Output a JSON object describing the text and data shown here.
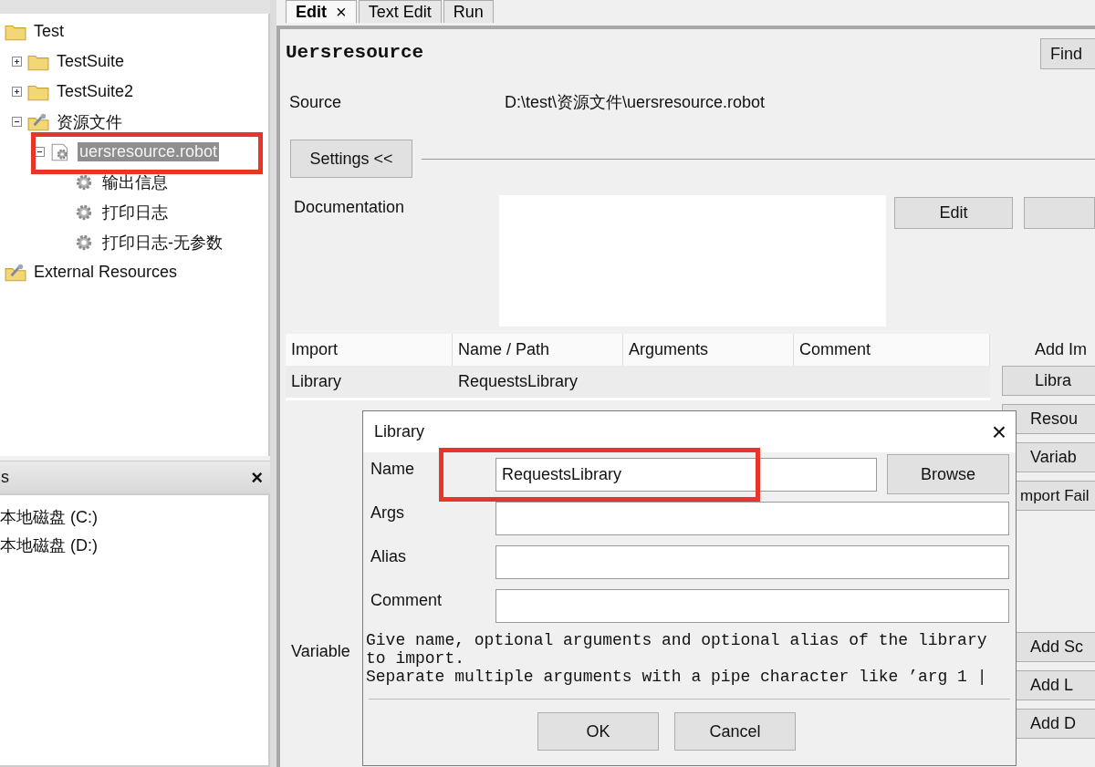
{
  "tree": [
    {
      "label": "Test",
      "kind": "folder",
      "children": [
        {
          "label": "TestSuite",
          "kind": "folder",
          "expanded": false
        },
        {
          "label": "TestSuite2",
          "kind": "folder",
          "expanded": false
        },
        {
          "label": "资源文件",
          "kind": "resource-folder",
          "expanded": true,
          "children": [
            {
              "label": "uersresource.robot",
              "kind": "resource-file",
              "expanded": true,
              "selected": true,
              "children": [
                {
                  "label": "输出信息",
                  "kind": "keyword"
                },
                {
                  "label": "打印日志",
                  "kind": "keyword"
                },
                {
                  "label": "打印日志-无参数",
                  "kind": "keyword"
                }
              ]
            }
          ]
        }
      ]
    },
    {
      "label": "External Resources",
      "kind": "resource-folder"
    }
  ],
  "drives_panel": {
    "title": "s",
    "close": "×",
    "items": [
      "本地磁盘 (C:)",
      "本地磁盘 (D:)"
    ]
  },
  "tabs": [
    {
      "label": "Edit",
      "selected": true,
      "close": "×"
    },
    {
      "label": "Text Edit",
      "selected": false
    },
    {
      "label": "Run",
      "selected": false
    }
  ],
  "editor": {
    "title": "Uersresource",
    "find_button": "Find",
    "source_label": "Source",
    "source_value": "D:\\test\\资源文件\\uersresource.robot",
    "settings_button": "Settings <<",
    "documentation_label": "Documentation",
    "doc_edit_button": "Edit",
    "import_table": {
      "columns": [
        "Import",
        "Name / Path",
        "Arguments",
        "Comment"
      ],
      "rows": [
        {
          "cells": [
            "Library",
            "RequestsLibrary"
          ]
        }
      ]
    },
    "add_import_label": "Add Im",
    "import_buttons": [
      "Libra",
      "Resou",
      "Variab",
      "mport Fail"
    ],
    "variables_label": "Variable",
    "add_buttons": [
      "Add Sc",
      "Add L",
      "Add D"
    ]
  },
  "dialog": {
    "title": "Library",
    "close": "×",
    "fields": [
      {
        "label": "Name",
        "value": "RequestsLibrary"
      },
      {
        "label": "Args"
      },
      {
        "label": "Alias"
      },
      {
        "label": "Comment"
      }
    ],
    "browse_button": "Browse",
    "help_lines": [
      "Give name, optional arguments and optional alias of the library",
      "to import.",
      "Separate multiple arguments with a pipe character like ’arg 1 |"
    ],
    "buttons": [
      "OK",
      "Cancel"
    ]
  }
}
